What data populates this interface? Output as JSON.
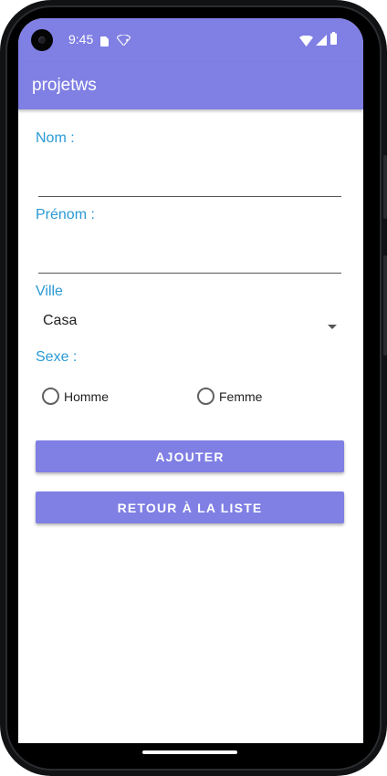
{
  "status_bar": {
    "time": "9:45",
    "icons": [
      "camera-icon",
      "sim-card-icon",
      "wifi-icon",
      "signal-icon",
      "battery-icon"
    ]
  },
  "app_bar": {
    "title": "projetws"
  },
  "form": {
    "nom": {
      "label": "Nom :",
      "value": ""
    },
    "prenom": {
      "label": "Prénom :",
      "value": ""
    },
    "ville": {
      "label": "Ville",
      "selected": "Casa"
    },
    "sexe": {
      "label": "Sexe :",
      "options": [
        {
          "label": "Homme",
          "selected": false
        },
        {
          "label": "Femme",
          "selected": false
        }
      ]
    }
  },
  "buttons": {
    "ajouter": "AJOUTER",
    "retour": "RETOUR À LA LISTE"
  },
  "colors": {
    "primary": "#7f7fe4",
    "label_accent": "#2a9ad4",
    "background": "#ffffff"
  }
}
